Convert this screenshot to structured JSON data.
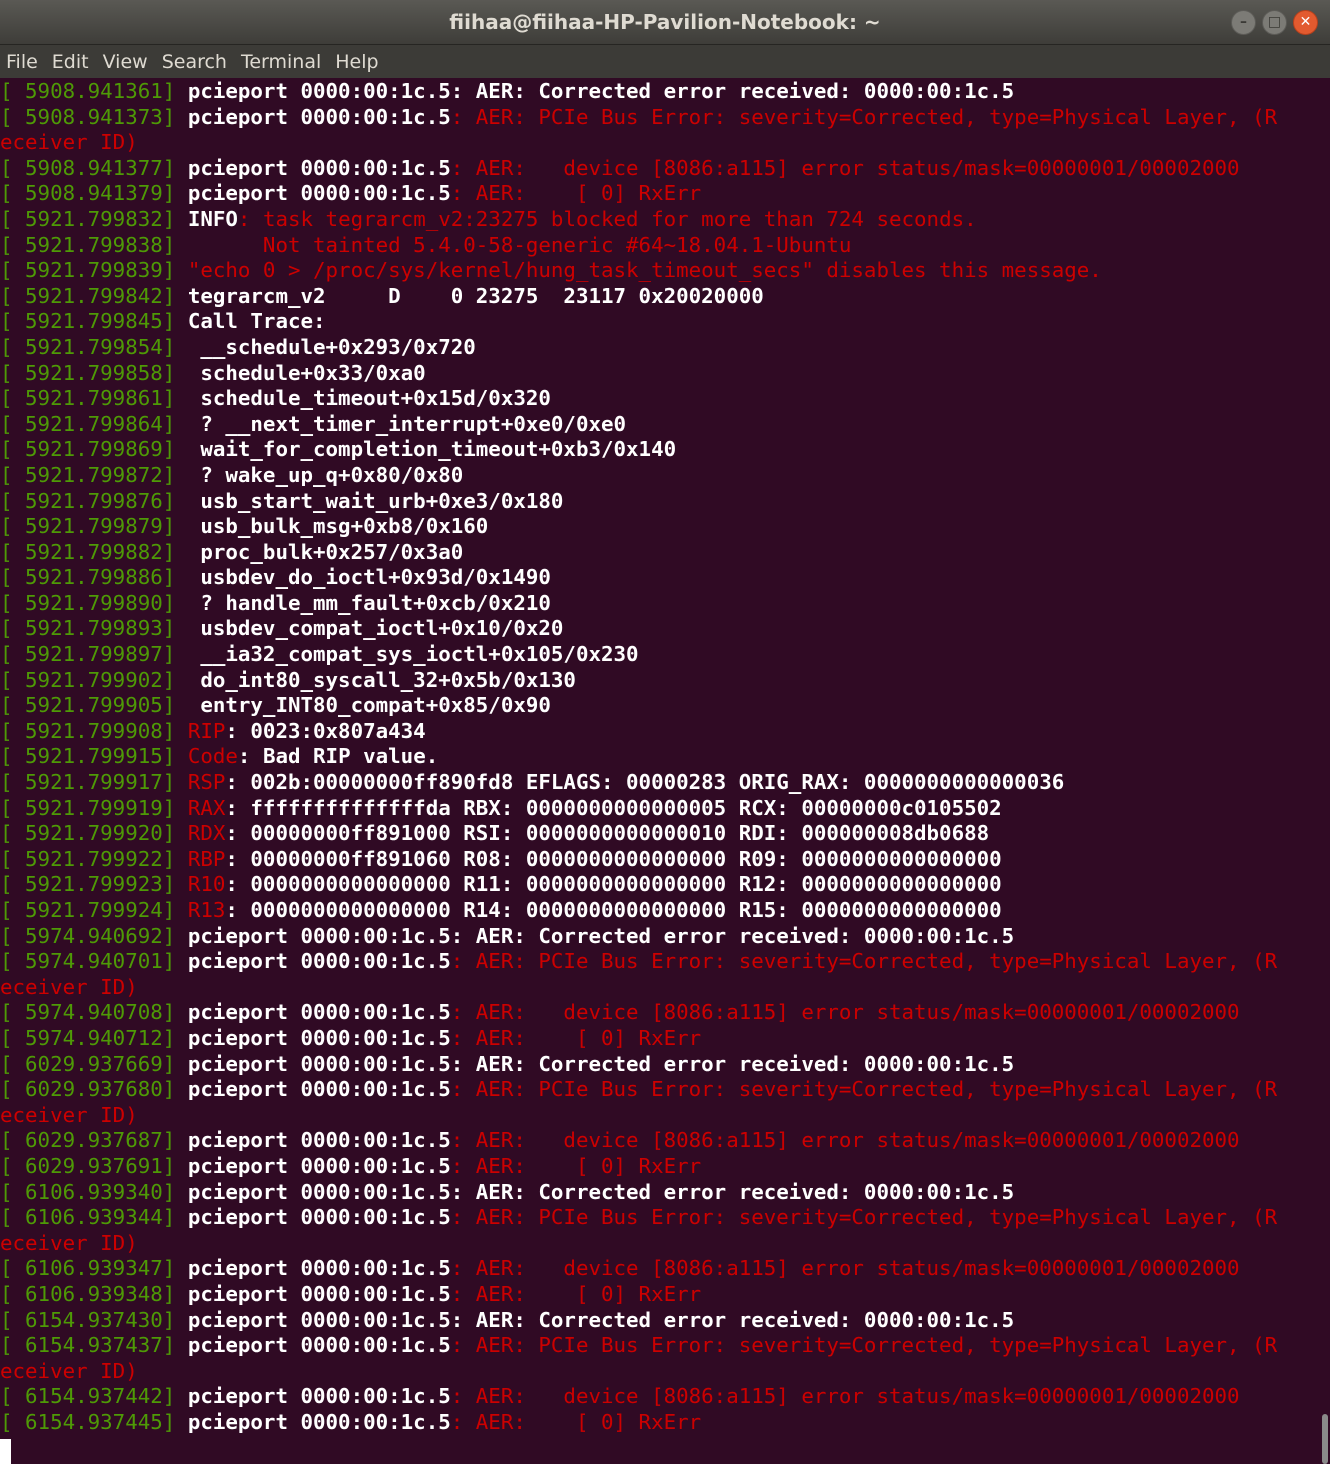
{
  "window": {
    "title": "fiihaa@fiihaa-HP-Pavilion-Notebook: ~",
    "buttons": {
      "minimize": "–",
      "maximize": "□",
      "close": "✕"
    }
  },
  "menubar": [
    "File",
    "Edit",
    "View",
    "Search",
    "Terminal",
    "Help"
  ],
  "colors": {
    "background": "#300a24",
    "timestamp": "#4e9a06",
    "error": "#cc0000",
    "text": "#ffffff"
  },
  "lines": [
    {
      "ts": "[ 5908.941361] ",
      "fac": "pcieport 0000:00:1c.5",
      "rest": ": AER: Corrected error received: 0000:00:1c.5",
      "style": "w"
    },
    {
      "ts": "[ 5908.941373] ",
      "fac": "pcieport 0000:00:1c.5",
      "rest": ": AER: PCIe Bus Error: severity=Corrected, type=Physical Layer, (R",
      "style": "r"
    },
    {
      "ts": "",
      "fac": "",
      "rest": "eceiver ID)",
      "style": "r"
    },
    {
      "ts": "[ 5908.941377] ",
      "fac": "pcieport 0000:00:1c.5",
      "rest": ": AER:   device [8086:a115] error status/mask=00000001/00002000",
      "style": "r"
    },
    {
      "ts": "[ 5908.941379] ",
      "fac": "pcieport 0000:00:1c.5",
      "rest": ": AER:    [ 0] RxErr",
      "style": "r"
    },
    {
      "ts": "[ 5921.799832] ",
      "fac": "INFO",
      "rest": ": task tegrarcm_v2:23275 blocked for more than 724 seconds.",
      "style": "r"
    },
    {
      "ts": "[ 5921.799838] ",
      "fac": "",
      "rest": "      Not tainted 5.4.0-58-generic #64~18.04.1-Ubuntu",
      "style": "r"
    },
    {
      "ts": "[ 5921.799839] ",
      "fac": "",
      "rest": "\"echo 0 > /proc/sys/kernel/hung_task_timeout_secs\" disables this message.",
      "style": "r"
    },
    {
      "ts": "[ 5921.799842] ",
      "fac": "",
      "rest": "tegrarcm_v2     D    0 23275  23117 0x20020000",
      "style": "w"
    },
    {
      "ts": "[ 5921.799845] ",
      "fac": "",
      "rest": "Call Trace:",
      "style": "w"
    },
    {
      "ts": "[ 5921.799854] ",
      "fac": "",
      "rest": " __schedule+0x293/0x720",
      "style": "w"
    },
    {
      "ts": "[ 5921.799858] ",
      "fac": "",
      "rest": " schedule+0x33/0xa0",
      "style": "w"
    },
    {
      "ts": "[ 5921.799861] ",
      "fac": "",
      "rest": " schedule_timeout+0x15d/0x320",
      "style": "w"
    },
    {
      "ts": "[ 5921.799864] ",
      "fac": "",
      "rest": " ? __next_timer_interrupt+0xe0/0xe0",
      "style": "w"
    },
    {
      "ts": "[ 5921.799869] ",
      "fac": "",
      "rest": " wait_for_completion_timeout+0xb3/0x140",
      "style": "w"
    },
    {
      "ts": "[ 5921.799872] ",
      "fac": "",
      "rest": " ? wake_up_q+0x80/0x80",
      "style": "w"
    },
    {
      "ts": "[ 5921.799876] ",
      "fac": "",
      "rest": " usb_start_wait_urb+0xe3/0x180",
      "style": "w"
    },
    {
      "ts": "[ 5921.799879] ",
      "fac": "",
      "rest": " usb_bulk_msg+0xb8/0x160",
      "style": "w"
    },
    {
      "ts": "[ 5921.799882] ",
      "fac": "",
      "rest": " proc_bulk+0x257/0x3a0",
      "style": "w"
    },
    {
      "ts": "[ 5921.799886] ",
      "fac": "",
      "rest": " usbdev_do_ioctl+0x93d/0x1490",
      "style": "w"
    },
    {
      "ts": "[ 5921.799890] ",
      "fac": "",
      "rest": " ? handle_mm_fault+0xcb/0x210",
      "style": "w"
    },
    {
      "ts": "[ 5921.799893] ",
      "fac": "",
      "rest": " usbdev_compat_ioctl+0x10/0x20",
      "style": "w"
    },
    {
      "ts": "[ 5921.799897] ",
      "fac": "",
      "rest": " __ia32_compat_sys_ioctl+0x105/0x230",
      "style": "w"
    },
    {
      "ts": "[ 5921.799902] ",
      "fac": "",
      "rest": " do_int80_syscall_32+0x5b/0x130",
      "style": "w"
    },
    {
      "ts": "[ 5921.799905] ",
      "fac": "",
      "rest": " entry_INT80_compat+0x85/0x90",
      "style": "w"
    },
    {
      "ts": "[ 5921.799908] ",
      "lbl": "RIP",
      "rest": ": 0023:0x807a434",
      "style": "w"
    },
    {
      "ts": "[ 5921.799915] ",
      "lbl": "Code",
      "rest": ": Bad RIP value.",
      "style": "w"
    },
    {
      "ts": "[ 5921.799917] ",
      "lbl": "RSP",
      "rest": ": 002b:00000000ff890fd8 EFLAGS: 00000283 ORIG_RAX: 0000000000000036",
      "style": "w"
    },
    {
      "ts": "[ 5921.799919] ",
      "lbl": "RAX",
      "rest": ": ffffffffffffffda RBX: 0000000000000005 RCX: 00000000c0105502",
      "style": "w"
    },
    {
      "ts": "[ 5921.799920] ",
      "lbl": "RDX",
      "rest": ": 00000000ff891000 RSI: 0000000000000010 RDI: 000000008db0688",
      "style": "w"
    },
    {
      "ts": "[ 5921.799922] ",
      "lbl": "RBP",
      "rest": ": 00000000ff891060 R08: 0000000000000000 R09: 0000000000000000",
      "style": "w"
    },
    {
      "ts": "[ 5921.799923] ",
      "lbl": "R10",
      "rest": ": 0000000000000000 R11: 0000000000000000 R12: 0000000000000000",
      "style": "w"
    },
    {
      "ts": "[ 5921.799924] ",
      "lbl": "R13",
      "rest": ": 0000000000000000 R14: 0000000000000000 R15: 0000000000000000",
      "style": "w"
    },
    {
      "ts": "[ 5974.940692] ",
      "fac": "pcieport 0000:00:1c.5",
      "rest": ": AER: Corrected error received: 0000:00:1c.5",
      "style": "w"
    },
    {
      "ts": "[ 5974.940701] ",
      "fac": "pcieport 0000:00:1c.5",
      "rest": ": AER: PCIe Bus Error: severity=Corrected, type=Physical Layer, (R",
      "style": "r"
    },
    {
      "ts": "",
      "fac": "",
      "rest": "eceiver ID)",
      "style": "r"
    },
    {
      "ts": "[ 5974.940708] ",
      "fac": "pcieport 0000:00:1c.5",
      "rest": ": AER:   device [8086:a115] error status/mask=00000001/00002000",
      "style": "r"
    },
    {
      "ts": "[ 5974.940712] ",
      "fac": "pcieport 0000:00:1c.5",
      "rest": ": AER:    [ 0] RxErr",
      "style": "r"
    },
    {
      "ts": "[ 6029.937669] ",
      "fac": "pcieport 0000:00:1c.5",
      "rest": ": AER: Corrected error received: 0000:00:1c.5",
      "style": "w"
    },
    {
      "ts": "[ 6029.937680] ",
      "fac": "pcieport 0000:00:1c.5",
      "rest": ": AER: PCIe Bus Error: severity=Corrected, type=Physical Layer, (R",
      "style": "r"
    },
    {
      "ts": "",
      "fac": "",
      "rest": "eceiver ID)",
      "style": "r"
    },
    {
      "ts": "[ 6029.937687] ",
      "fac": "pcieport 0000:00:1c.5",
      "rest": ": AER:   device [8086:a115] error status/mask=00000001/00002000",
      "style": "r"
    },
    {
      "ts": "[ 6029.937691] ",
      "fac": "pcieport 0000:00:1c.5",
      "rest": ": AER:    [ 0] RxErr",
      "style": "r"
    },
    {
      "ts": "[ 6106.939340] ",
      "fac": "pcieport 0000:00:1c.5",
      "rest": ": AER: Corrected error received: 0000:00:1c.5",
      "style": "w"
    },
    {
      "ts": "[ 6106.939344] ",
      "fac": "pcieport 0000:00:1c.5",
      "rest": ": AER: PCIe Bus Error: severity=Corrected, type=Physical Layer, (R",
      "style": "r"
    },
    {
      "ts": "",
      "fac": "",
      "rest": "eceiver ID)",
      "style": "r"
    },
    {
      "ts": "[ 6106.939347] ",
      "fac": "pcieport 0000:00:1c.5",
      "rest": ": AER:   device [8086:a115] error status/mask=00000001/00002000",
      "style": "r"
    },
    {
      "ts": "[ 6106.939348] ",
      "fac": "pcieport 0000:00:1c.5",
      "rest": ": AER:    [ 0] RxErr",
      "style": "r"
    },
    {
      "ts": "[ 6154.937430] ",
      "fac": "pcieport 0000:00:1c.5",
      "rest": ": AER: Corrected error received: 0000:00:1c.5",
      "style": "w"
    },
    {
      "ts": "[ 6154.937437] ",
      "fac": "pcieport 0000:00:1c.5",
      "rest": ": AER: PCIe Bus Error: severity=Corrected, type=Physical Layer, (R",
      "style": "r"
    },
    {
      "ts": "",
      "fac": "",
      "rest": "eceiver ID)",
      "style": "r"
    },
    {
      "ts": "[ 6154.937442] ",
      "fac": "pcieport 0000:00:1c.5",
      "rest": ": AER:   device [8086:a115] error status/mask=00000001/00002000",
      "style": "r"
    },
    {
      "ts": "[ 6154.937445] ",
      "fac": "pcieport 0000:00:1c.5",
      "rest": ": AER:    [ 0] RxErr",
      "style": "r"
    }
  ]
}
